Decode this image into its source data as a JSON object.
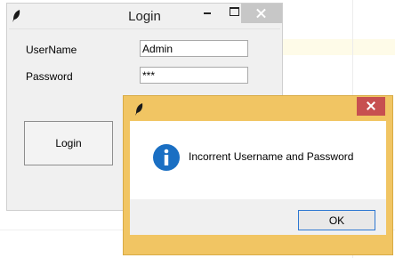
{
  "login_window": {
    "title": "Login",
    "username_label": "UserName",
    "password_label": "Password",
    "username_value": "Admin",
    "password_value": "***",
    "login_button": "Login"
  },
  "error_dialog": {
    "message": "Incorrent Username and Password",
    "ok_button": "OK",
    "icon": "info-icon"
  },
  "colors": {
    "dialog_frame": "#f1c563",
    "close_button": "#c75050",
    "info_icon": "#1a6fc3"
  }
}
